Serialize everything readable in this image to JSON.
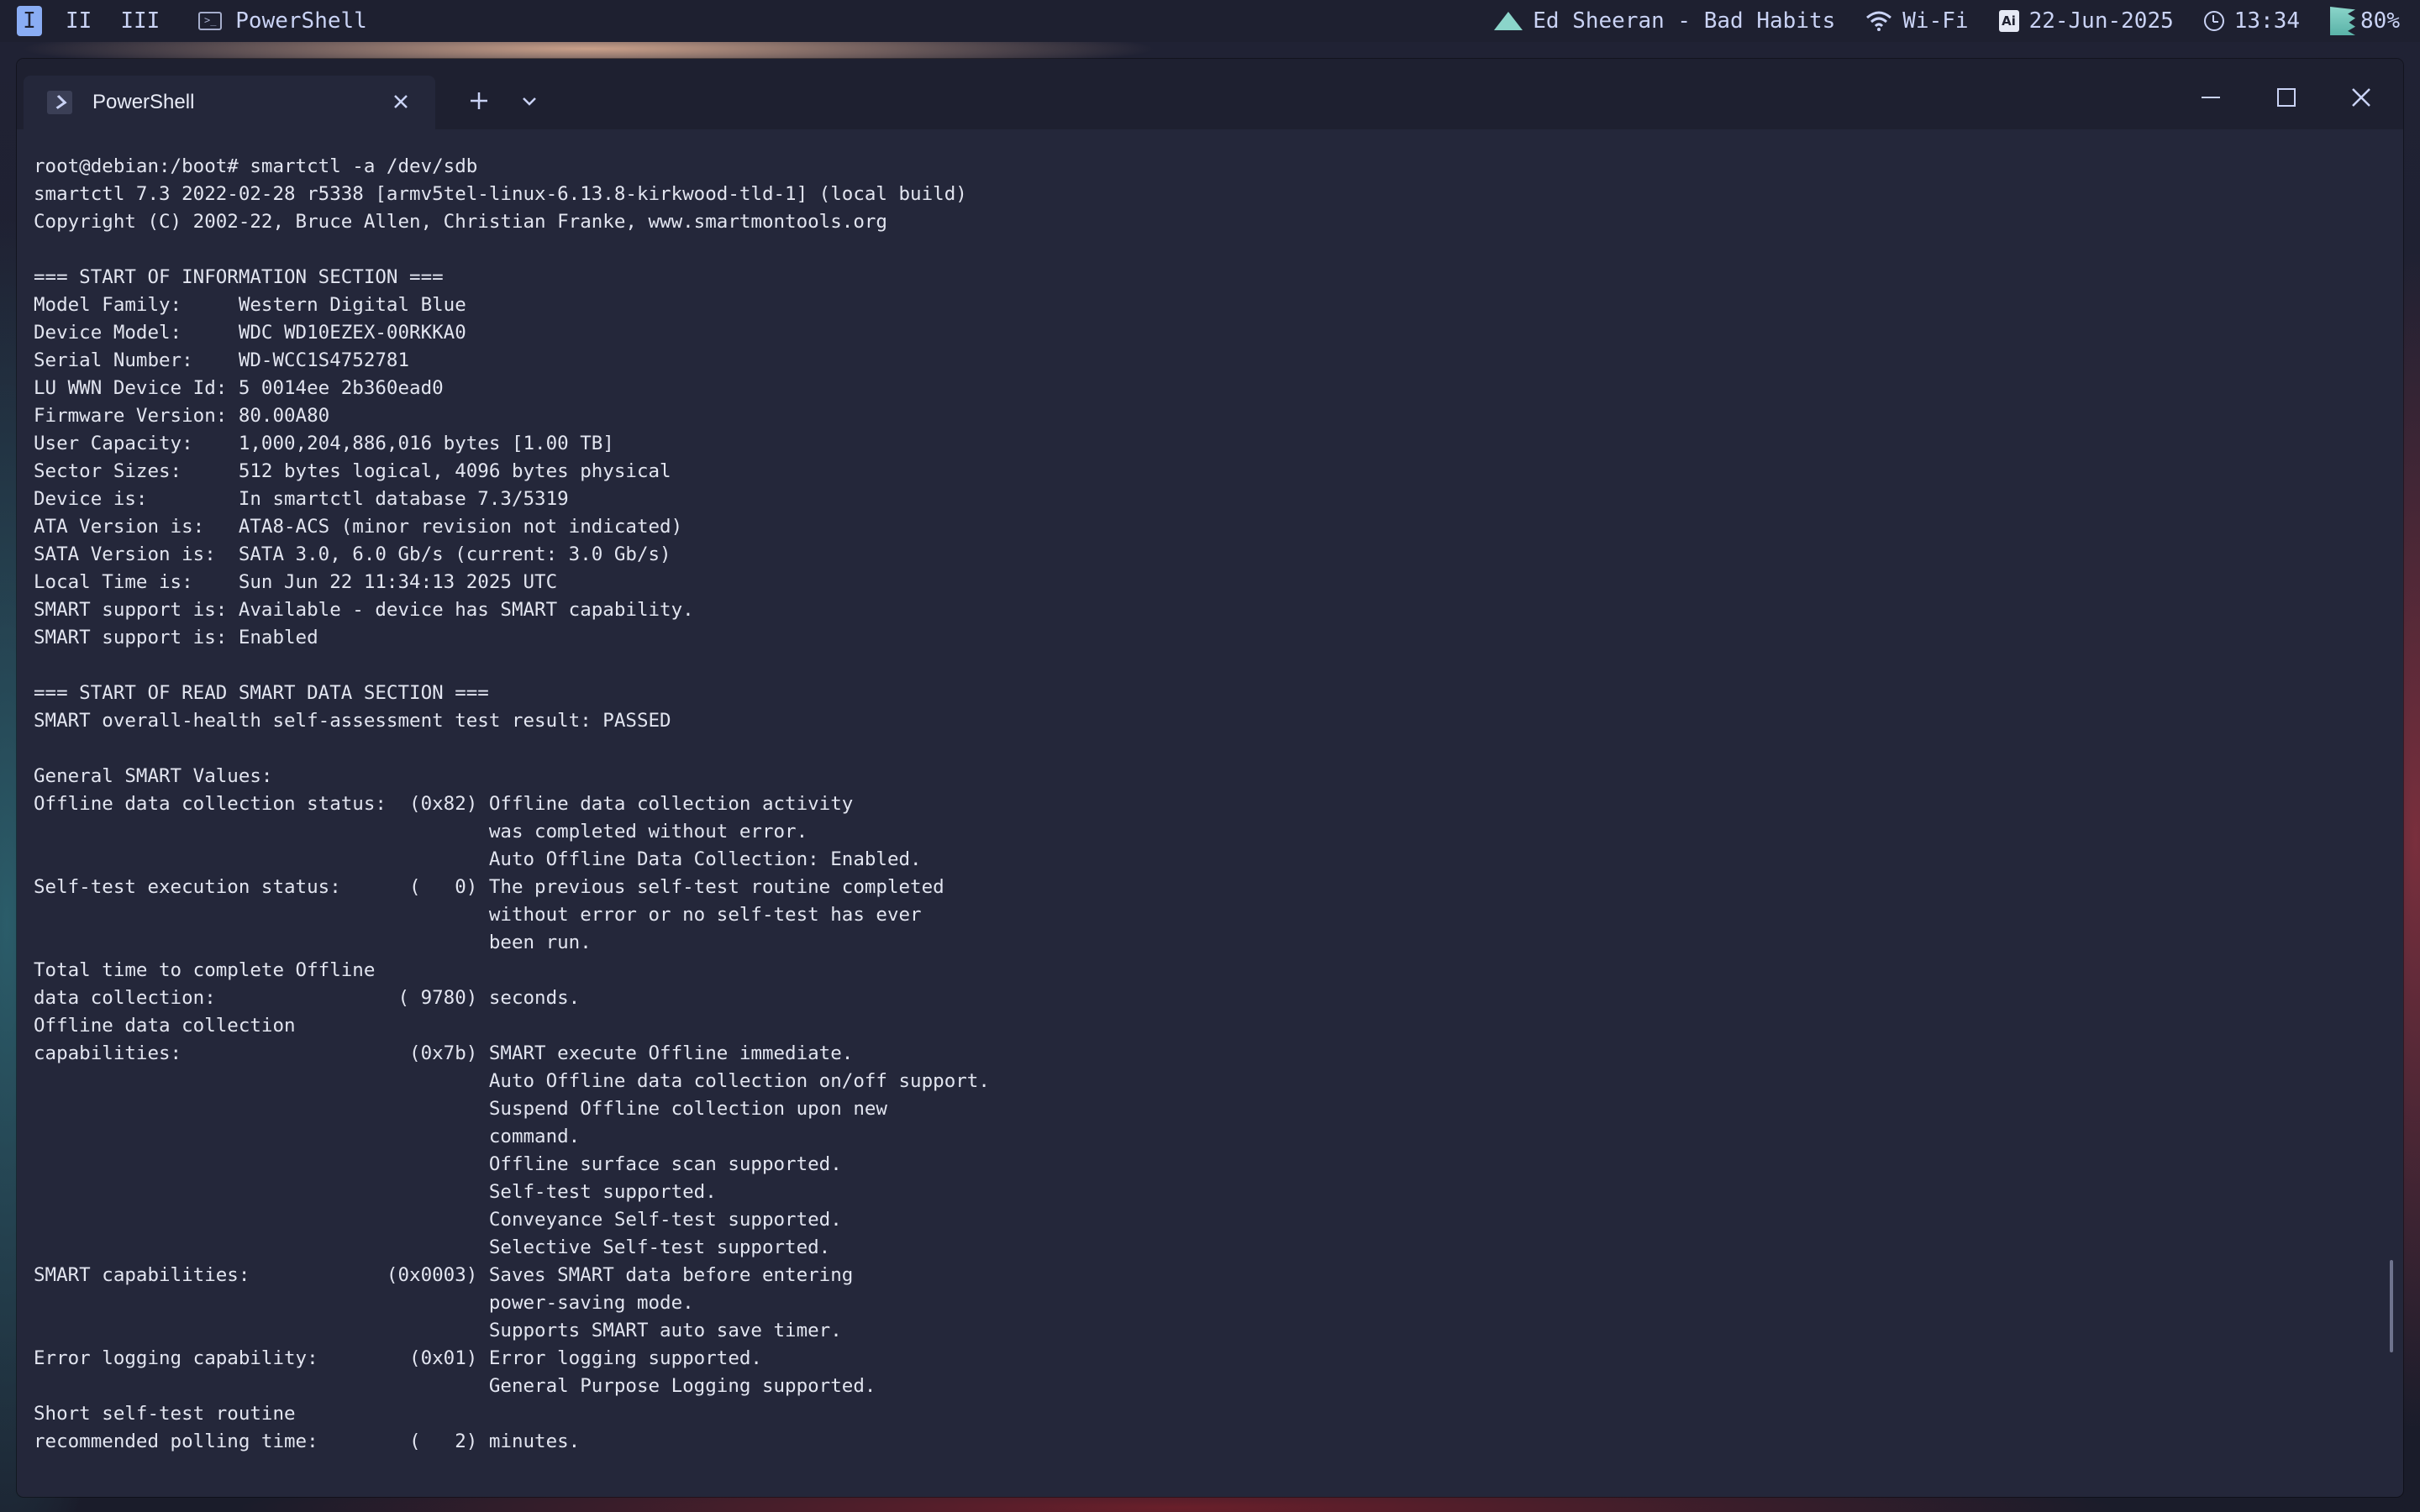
{
  "topbar": {
    "workspaces": [
      "I",
      "II",
      "III"
    ],
    "active_app": "PowerShell",
    "media": "Ed Sheeran - Bad Habits",
    "network": "Wi-Fi",
    "date": "22-Jun-2025",
    "time": "13:34",
    "battery": "80%"
  },
  "window": {
    "tab_title": "PowerShell",
    "new_tab": "+",
    "close": "✕"
  },
  "terminal": {
    "lines": [
      "root@debian:/boot# smartctl -a /dev/sdb",
      "smartctl 7.3 2022-02-28 r5338 [armv5tel-linux-6.13.8-kirkwood-tld-1] (local build)",
      "Copyright (C) 2002-22, Bruce Allen, Christian Franke, www.smartmontools.org",
      "",
      "=== START OF INFORMATION SECTION ===",
      "Model Family:     Western Digital Blue",
      "Device Model:     WDC WD10EZEX-00RKKA0",
      "Serial Number:    WD-WCC1S4752781",
      "LU WWN Device Id: 5 0014ee 2b360ead0",
      "Firmware Version: 80.00A80",
      "User Capacity:    1,000,204,886,016 bytes [1.00 TB]",
      "Sector Sizes:     512 bytes logical, 4096 bytes physical",
      "Device is:        In smartctl database 7.3/5319",
      "ATA Version is:   ATA8-ACS (minor revision not indicated)",
      "SATA Version is:  SATA 3.0, 6.0 Gb/s (current: 3.0 Gb/s)",
      "Local Time is:    Sun Jun 22 11:34:13 2025 UTC",
      "SMART support is: Available - device has SMART capability.",
      "SMART support is: Enabled",
      "",
      "=== START OF READ SMART DATA SECTION ===",
      "SMART overall-health self-assessment test result: PASSED",
      "",
      "General SMART Values:",
      "Offline data collection status:  (0x82) Offline data collection activity",
      "                                        was completed without error.",
      "                                        Auto Offline Data Collection: Enabled.",
      "Self-test execution status:      (   0) The previous self-test routine completed",
      "                                        without error or no self-test has ever",
      "                                        been run.",
      "Total time to complete Offline",
      "data collection:                ( 9780) seconds.",
      "Offline data collection",
      "capabilities:                    (0x7b) SMART execute Offline immediate.",
      "                                        Auto Offline data collection on/off support.",
      "                                        Suspend Offline collection upon new",
      "                                        command.",
      "                                        Offline surface scan supported.",
      "                                        Self-test supported.",
      "                                        Conveyance Self-test supported.",
      "                                        Selective Self-test supported.",
      "SMART capabilities:            (0x0003) Saves SMART data before entering",
      "                                        power-saving mode.",
      "                                        Supports SMART auto save timer.",
      "Error logging capability:        (0x01) Error logging supported.",
      "                                        General Purpose Logging supported.",
      "Short self-test routine",
      "recommended polling time:        (   2) minutes."
    ]
  }
}
